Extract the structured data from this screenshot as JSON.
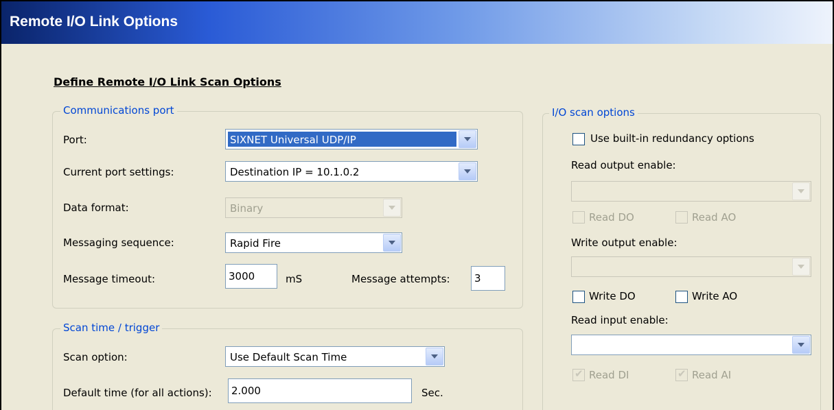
{
  "window": {
    "title": "Remote I/O Link Options"
  },
  "heading": "Define Remote I/O Link Scan Options",
  "comm": {
    "legend": "Communications port",
    "port_label": "Port:",
    "port_value": "SIXNET Universal UDP/IP",
    "settings_label": "Current port settings:",
    "settings_value": "Destination IP = 10.1.0.2",
    "format_label": "Data format:",
    "format_value": "Binary",
    "sequence_label": "Messaging sequence:",
    "sequence_value": "Rapid Fire",
    "timeout_label": "Message timeout:",
    "timeout_value": "3000",
    "timeout_unit": "mS",
    "attempts_label": "Message attempts:",
    "attempts_value": "3"
  },
  "scan": {
    "legend": "Scan time / trigger",
    "option_label": "Scan option:",
    "option_value": "Use Default Scan Time",
    "default_label": "Default time (for all actions):",
    "default_value": "2.000",
    "default_unit": "Sec."
  },
  "io": {
    "legend": "I/O scan options",
    "redundancy_label": "Use built-in redundancy options",
    "read_output_label": "Read output enable:",
    "read_do": "Read DO",
    "read_ao": "Read AO",
    "write_output_label": "Write output enable:",
    "write_do": "Write DO",
    "write_ao": "Write AO",
    "read_input_label": "Read input enable:",
    "read_di": "Read DI",
    "read_ai": "Read AI"
  }
}
